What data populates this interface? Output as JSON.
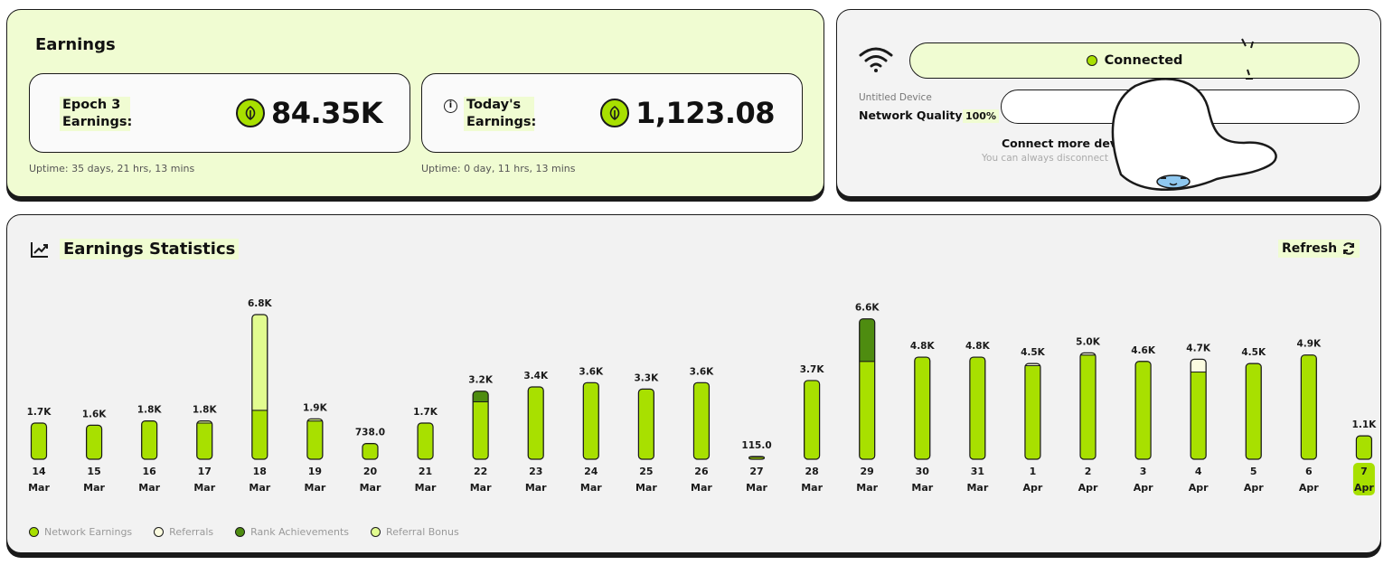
{
  "earnings": {
    "title": "Earnings",
    "epoch": {
      "label": "Epoch 3 Earnings:",
      "value": "84.35K",
      "uptime": "Uptime: 35 days, 21 hrs, 13 mins"
    },
    "today": {
      "label": "Today's Earnings:",
      "value": "1,123.08",
      "uptime": "Uptime: 0 day, 11 hrs, 13 mins"
    }
  },
  "device": {
    "status": "Connected",
    "name": "Untitled Device",
    "network_quality_label": "Network Quality:",
    "network_quality_value": "100%",
    "connect_more": "Connect more devi",
    "disconnect_hint": "You can always disconnect"
  },
  "stats": {
    "title": "Earnings Statistics",
    "refresh_label": "Refresh",
    "legend": [
      {
        "label": "Network Earnings",
        "color": "#a8e000"
      },
      {
        "label": "Referrals",
        "color": "#fcfce0"
      },
      {
        "label": "Rank Achievements",
        "color": "#4e8c10"
      },
      {
        "label": "Referral Bonus",
        "color": "#e2fc90"
      }
    ]
  },
  "chart_data": {
    "type": "bar",
    "stacked": true,
    "categories": [
      "14 Mar",
      "15 Mar",
      "16 Mar",
      "17 Mar",
      "18 Mar",
      "19 Mar",
      "20 Mar",
      "21 Mar",
      "22 Mar",
      "23 Mar",
      "24 Mar",
      "25 Mar",
      "26 Mar",
      "27 Mar",
      "28 Mar",
      "29 Mar",
      "30 Mar",
      "31 Mar",
      "1 Apr",
      "2 Apr",
      "3 Apr",
      "4 Apr",
      "5 Apr",
      "6 Apr",
      "7 Apr"
    ],
    "day_labels": [
      "14",
      "15",
      "16",
      "17",
      "18",
      "19",
      "20",
      "21",
      "22",
      "23",
      "24",
      "25",
      "26",
      "27",
      "28",
      "29",
      "30",
      "31",
      "1",
      "2",
      "3",
      "4",
      "5",
      "6",
      "7"
    ],
    "month_labels": [
      "Mar",
      "Mar",
      "Mar",
      "Mar",
      "Mar",
      "Mar",
      "Mar",
      "Mar",
      "Mar",
      "Mar",
      "Mar",
      "Mar",
      "Mar",
      "Mar",
      "Mar",
      "Mar",
      "Mar",
      "Mar",
      "Apr",
      "Apr",
      "Apr",
      "Apr",
      "Apr",
      "Apr",
      "Apr"
    ],
    "total_labels": [
      "1.7K",
      "1.6K",
      "1.8K",
      "1.8K",
      "6.8K",
      "1.9K",
      "738.0",
      "1.7K",
      "3.2K",
      "3.4K",
      "3.6K",
      "3.3K",
      "3.6K",
      "115.0",
      "3.7K",
      "6.6K",
      "4.8K",
      "4.8K",
      "4.5K",
      "5.0K",
      "4.6K",
      "4.7K",
      "4.5K",
      "4.9K",
      "1.1K"
    ],
    "series": [
      {
        "name": "Network Earnings",
        "values": [
          1700,
          1600,
          1800,
          1700,
          2300,
          1800,
          738,
          1700,
          2700,
          3400,
          3600,
          3300,
          3600,
          100,
          3700,
          4600,
          4800,
          4800,
          4400,
          4900,
          4600,
          4100,
          4500,
          4900,
          1100
        ]
      },
      {
        "name": "Referrals",
        "values": [
          0,
          0,
          0,
          0,
          0,
          0,
          0,
          0,
          0,
          0,
          0,
          0,
          0,
          15,
          0,
          0,
          0,
          0,
          100,
          100,
          0,
          600,
          0,
          0,
          0
        ]
      },
      {
        "name": "Rank Achievements",
        "values": [
          0,
          0,
          0,
          0,
          0,
          0,
          0,
          0,
          500,
          0,
          0,
          0,
          0,
          0,
          0,
          2000,
          0,
          0,
          0,
          0,
          0,
          0,
          0,
          0,
          0
        ]
      },
      {
        "name": "Referral Bonus",
        "values": [
          0,
          0,
          0,
          100,
          4500,
          100,
          0,
          0,
          0,
          0,
          0,
          0,
          0,
          0,
          0,
          0,
          0,
          0,
          0,
          0,
          0,
          0,
          0,
          0,
          0
        ]
      }
    ],
    "highlighted_category": "7 Apr",
    "ylim": [
      0,
      6800
    ]
  }
}
